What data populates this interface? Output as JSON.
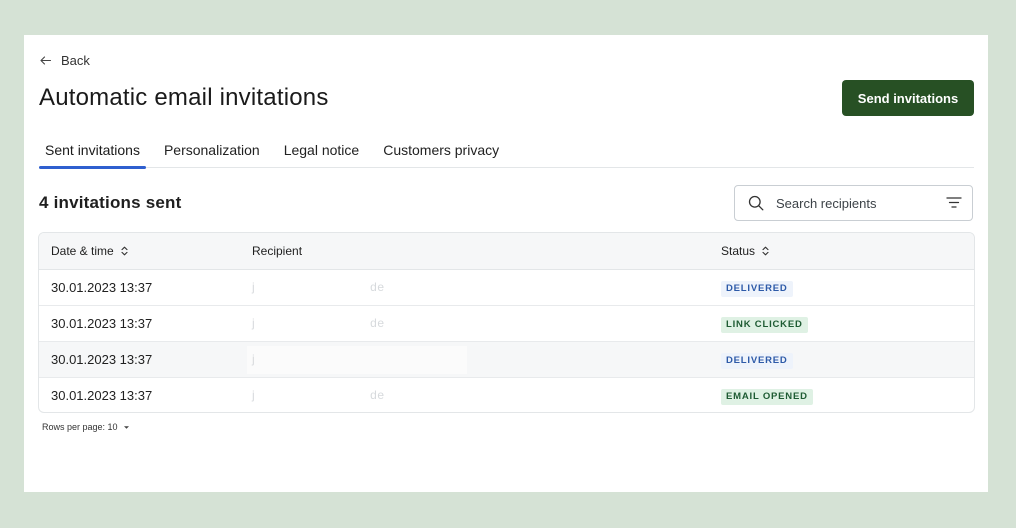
{
  "header": {
    "back_label": "Back",
    "title": "Automatic email invitations",
    "send_button": "Send invitations"
  },
  "tabs": [
    {
      "label": "Sent invitations",
      "active": true
    },
    {
      "label": "Personalization",
      "active": false
    },
    {
      "label": "Legal notice",
      "active": false
    },
    {
      "label": "Customers privacy",
      "active": false
    }
  ],
  "summary": {
    "count_text": "4 invitations sent"
  },
  "search": {
    "placeholder": "Search recipients",
    "value": ""
  },
  "table": {
    "columns": [
      "Date & time",
      "Recipient",
      "Status"
    ],
    "rows": [
      {
        "datetime": "30.01.2023 13:37",
        "recipient": "j                              de",
        "status": "DELIVERED"
      },
      {
        "datetime": "30.01.2023 13:37",
        "recipient": "j                              de",
        "status": "LINK CLICKED"
      },
      {
        "datetime": "30.01.2023 13:37",
        "recipient": "j",
        "status": "DELIVERED"
      },
      {
        "datetime": "30.01.2023 13:37",
        "recipient": "j                              de",
        "status": "EMAIL OPENED"
      }
    ]
  },
  "footer": {
    "rows_per_page": "Rows per page: 10"
  },
  "colors": {
    "background": "#d5e2d5",
    "primary": "#275024",
    "tab_indicator": "#2f5fcf",
    "badge_delivered_bg": "#eef3fb",
    "badge_delivered_text": "#2d5aa8",
    "badge_green_bg": "#dff1e4",
    "badge_green_text": "#1e5b33"
  },
  "icons": {
    "back": "arrow-left-icon",
    "search": "search-icon",
    "filter": "filter-icon",
    "sort": "sort-icon",
    "dropdown": "caret-down-icon"
  }
}
